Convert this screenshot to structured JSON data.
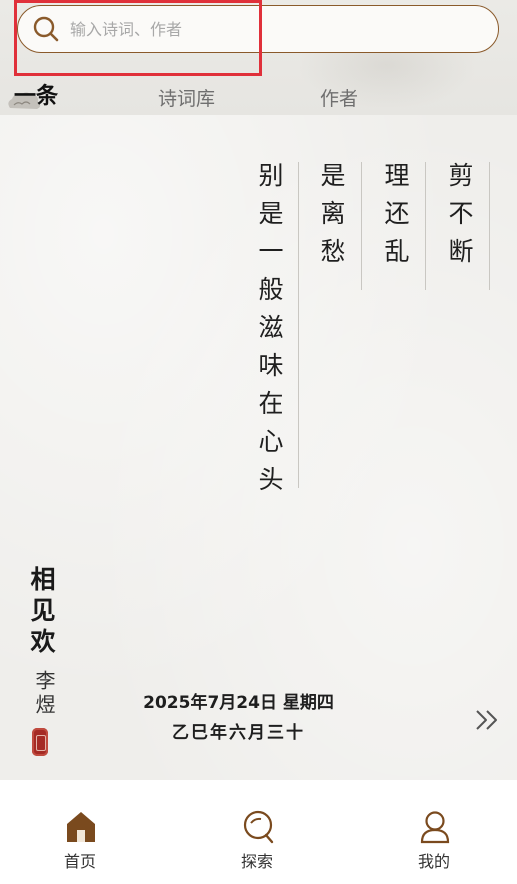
{
  "search": {
    "placeholder": "输入诗词、作者",
    "value": ""
  },
  "tabs": [
    {
      "label": "一条",
      "active": true
    },
    {
      "label": "诗词库",
      "active": false
    },
    {
      "label": "作者",
      "active": false
    }
  ],
  "poem": {
    "title": "相见欢",
    "author": "李煜",
    "lines": [
      "剪不断",
      "理还乱",
      "是离愁",
      "别是一般滋味在心头"
    ]
  },
  "date": {
    "gregorian": "2025年7月24日 星期四",
    "lunar": "乙巳年六月三十"
  },
  "bottom_nav": [
    {
      "label": "首页",
      "icon": "home-icon",
      "active": true
    },
    {
      "label": "探索",
      "icon": "explore-icon",
      "active": false
    },
    {
      "label": "我的",
      "icon": "profile-icon",
      "active": false
    }
  ],
  "colors": {
    "accent": "#8a5a2b",
    "highlight": "#e0303a",
    "seal": "#a52a24"
  }
}
